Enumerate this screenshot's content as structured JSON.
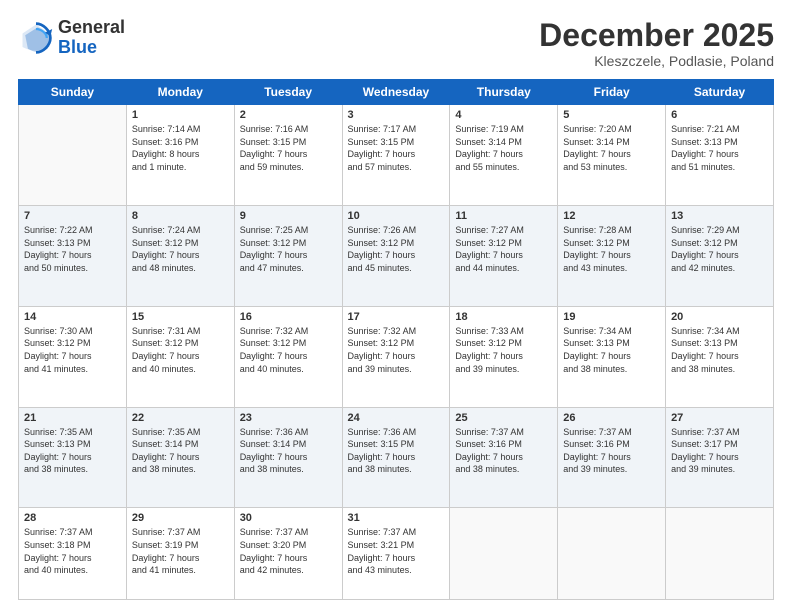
{
  "header": {
    "logo_general": "General",
    "logo_blue": "Blue",
    "month_title": "December 2025",
    "subtitle": "Kleszczele, Podlasie, Poland"
  },
  "days_of_week": [
    "Sunday",
    "Monday",
    "Tuesday",
    "Wednesday",
    "Thursday",
    "Friday",
    "Saturday"
  ],
  "weeks": [
    [
      {
        "day": "",
        "info": ""
      },
      {
        "day": "1",
        "info": "Sunrise: 7:14 AM\nSunset: 3:16 PM\nDaylight: 8 hours\nand 1 minute."
      },
      {
        "day": "2",
        "info": "Sunrise: 7:16 AM\nSunset: 3:15 PM\nDaylight: 7 hours\nand 59 minutes."
      },
      {
        "day": "3",
        "info": "Sunrise: 7:17 AM\nSunset: 3:15 PM\nDaylight: 7 hours\nand 57 minutes."
      },
      {
        "day": "4",
        "info": "Sunrise: 7:19 AM\nSunset: 3:14 PM\nDaylight: 7 hours\nand 55 minutes."
      },
      {
        "day": "5",
        "info": "Sunrise: 7:20 AM\nSunset: 3:14 PM\nDaylight: 7 hours\nand 53 minutes."
      },
      {
        "day": "6",
        "info": "Sunrise: 7:21 AM\nSunset: 3:13 PM\nDaylight: 7 hours\nand 51 minutes."
      }
    ],
    [
      {
        "day": "7",
        "info": "Sunrise: 7:22 AM\nSunset: 3:13 PM\nDaylight: 7 hours\nand 50 minutes."
      },
      {
        "day": "8",
        "info": "Sunrise: 7:24 AM\nSunset: 3:12 PM\nDaylight: 7 hours\nand 48 minutes."
      },
      {
        "day": "9",
        "info": "Sunrise: 7:25 AM\nSunset: 3:12 PM\nDaylight: 7 hours\nand 47 minutes."
      },
      {
        "day": "10",
        "info": "Sunrise: 7:26 AM\nSunset: 3:12 PM\nDaylight: 7 hours\nand 45 minutes."
      },
      {
        "day": "11",
        "info": "Sunrise: 7:27 AM\nSunset: 3:12 PM\nDaylight: 7 hours\nand 44 minutes."
      },
      {
        "day": "12",
        "info": "Sunrise: 7:28 AM\nSunset: 3:12 PM\nDaylight: 7 hours\nand 43 minutes."
      },
      {
        "day": "13",
        "info": "Sunrise: 7:29 AM\nSunset: 3:12 PM\nDaylight: 7 hours\nand 42 minutes."
      }
    ],
    [
      {
        "day": "14",
        "info": "Sunrise: 7:30 AM\nSunset: 3:12 PM\nDaylight: 7 hours\nand 41 minutes."
      },
      {
        "day": "15",
        "info": "Sunrise: 7:31 AM\nSunset: 3:12 PM\nDaylight: 7 hours\nand 40 minutes."
      },
      {
        "day": "16",
        "info": "Sunrise: 7:32 AM\nSunset: 3:12 PM\nDaylight: 7 hours\nand 40 minutes."
      },
      {
        "day": "17",
        "info": "Sunrise: 7:32 AM\nSunset: 3:12 PM\nDaylight: 7 hours\nand 39 minutes."
      },
      {
        "day": "18",
        "info": "Sunrise: 7:33 AM\nSunset: 3:12 PM\nDaylight: 7 hours\nand 39 minutes."
      },
      {
        "day": "19",
        "info": "Sunrise: 7:34 AM\nSunset: 3:13 PM\nDaylight: 7 hours\nand 38 minutes."
      },
      {
        "day": "20",
        "info": "Sunrise: 7:34 AM\nSunset: 3:13 PM\nDaylight: 7 hours\nand 38 minutes."
      }
    ],
    [
      {
        "day": "21",
        "info": "Sunrise: 7:35 AM\nSunset: 3:13 PM\nDaylight: 7 hours\nand 38 minutes."
      },
      {
        "day": "22",
        "info": "Sunrise: 7:35 AM\nSunset: 3:14 PM\nDaylight: 7 hours\nand 38 minutes."
      },
      {
        "day": "23",
        "info": "Sunrise: 7:36 AM\nSunset: 3:14 PM\nDaylight: 7 hours\nand 38 minutes."
      },
      {
        "day": "24",
        "info": "Sunrise: 7:36 AM\nSunset: 3:15 PM\nDaylight: 7 hours\nand 38 minutes."
      },
      {
        "day": "25",
        "info": "Sunrise: 7:37 AM\nSunset: 3:16 PM\nDaylight: 7 hours\nand 38 minutes."
      },
      {
        "day": "26",
        "info": "Sunrise: 7:37 AM\nSunset: 3:16 PM\nDaylight: 7 hours\nand 39 minutes."
      },
      {
        "day": "27",
        "info": "Sunrise: 7:37 AM\nSunset: 3:17 PM\nDaylight: 7 hours\nand 39 minutes."
      }
    ],
    [
      {
        "day": "28",
        "info": "Sunrise: 7:37 AM\nSunset: 3:18 PM\nDaylight: 7 hours\nand 40 minutes."
      },
      {
        "day": "29",
        "info": "Sunrise: 7:37 AM\nSunset: 3:19 PM\nDaylight: 7 hours\nand 41 minutes."
      },
      {
        "day": "30",
        "info": "Sunrise: 7:37 AM\nSunset: 3:20 PM\nDaylight: 7 hours\nand 42 minutes."
      },
      {
        "day": "31",
        "info": "Sunrise: 7:37 AM\nSunset: 3:21 PM\nDaylight: 7 hours\nand 43 minutes."
      },
      {
        "day": "",
        "info": ""
      },
      {
        "day": "",
        "info": ""
      },
      {
        "day": "",
        "info": ""
      }
    ]
  ]
}
